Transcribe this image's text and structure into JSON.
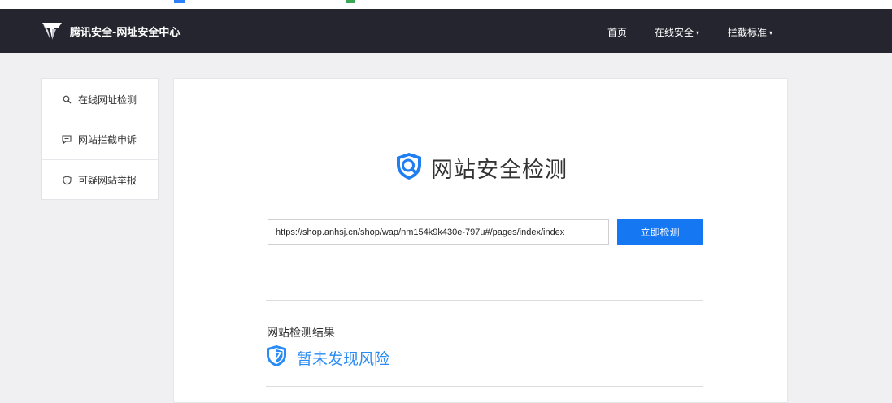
{
  "header": {
    "brand_title": "腾讯安全-网址安全中心",
    "nav": [
      {
        "label": "首页",
        "caret": ""
      },
      {
        "label": "在线安全",
        "caret": "▾"
      },
      {
        "label": "拦截标准",
        "caret": "▾"
      }
    ]
  },
  "sidebar": {
    "items": [
      {
        "label": "在线网址检测",
        "icon": "search-icon"
      },
      {
        "label": "网站拦截申诉",
        "icon": "message-icon"
      },
      {
        "label": "可疑网站举报",
        "icon": "shield-icon"
      }
    ]
  },
  "main": {
    "title": "网站安全检测",
    "url_value": "https://shop.anhsj.cn/shop/wap/nm154k9k430e-797u#/pages/index/index",
    "check_button": "立即检测",
    "result_label": "网站检测结果",
    "result_text": "暂未发现风险"
  },
  "colors": {
    "navbar": "#24252e",
    "accent": "#1677f2",
    "result": "#2a8bf2",
    "background": "#f0f0f3"
  }
}
